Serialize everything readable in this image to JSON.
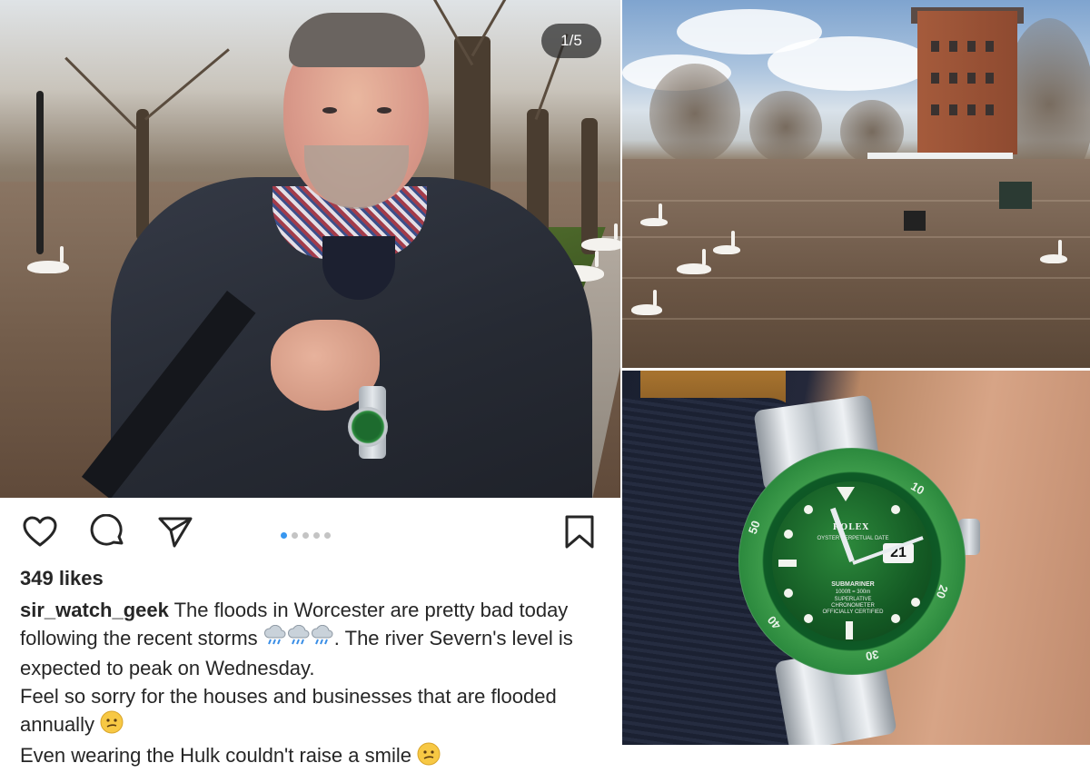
{
  "carousel": {
    "counter": "1/5",
    "dot_count": 5,
    "active_dot_index": 0
  },
  "post": {
    "likes": "349 likes",
    "username": "sir_watch_geek",
    "caption_line1": "The floods in Worcester are pretty bad today following the recent storms",
    "caption_line1_tail": ". The river Severn's level is expected to peak on Wednesday.",
    "caption_line2": "Feel so sorry for the houses and businesses that are flooded annually",
    "caption_line3": "Even wearing the Hulk couldn't raise a smile",
    "storm_emoji_count": 3
  },
  "watch": {
    "brand": "ROLEX",
    "dial_text": "OYSTER PERPETUAL DATE",
    "model": "SUBMARINER",
    "depth": "1000ft = 300m",
    "cert": "SUPERLATIVE CHRONOMETER OFFICIALLY CERTIFIED",
    "date": "21",
    "bezel_numbers": [
      "10",
      "20",
      "30",
      "40",
      "50"
    ]
  },
  "colors": {
    "active_dot": "#3897f0",
    "inactive_dot": "#c4c4c4",
    "text": "#262626"
  },
  "icons": {
    "like": "heart-icon",
    "comment": "comment-icon",
    "share": "send-icon",
    "save": "bookmark-icon"
  }
}
